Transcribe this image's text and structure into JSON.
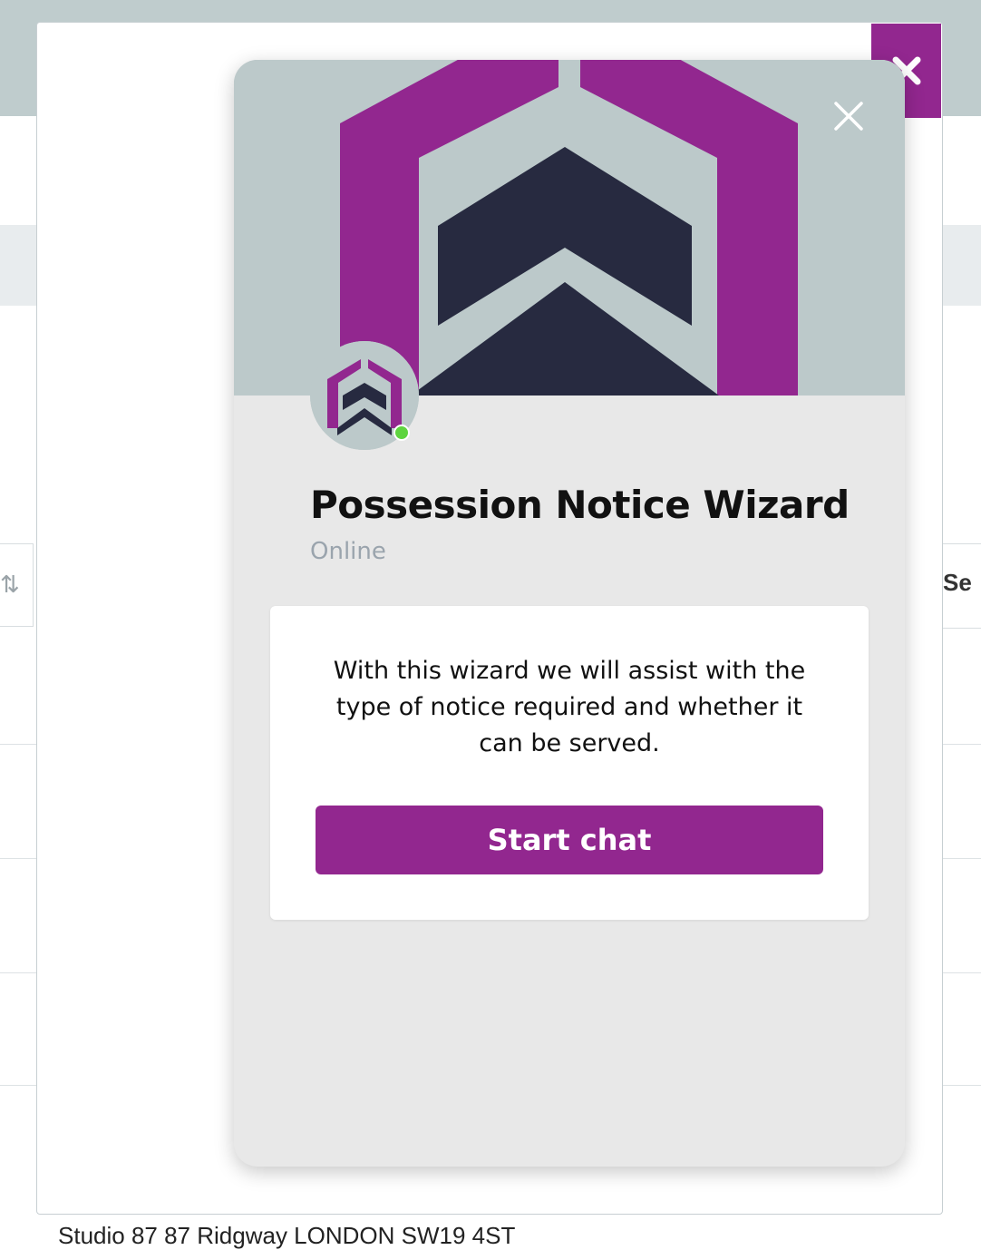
{
  "background_page": {
    "column_header_partial": "Se",
    "sort_icon": "sort-arrows-icon",
    "address_line": "Studio 87 87 Ridgway LONDON SW19 4ST"
  },
  "modal": {
    "close_icon": "close-x-icon"
  },
  "chat_widget": {
    "close_icon": "close-icon",
    "title": "Possession Notice Wizard",
    "status": "Online",
    "intro_message": "With this wizard we will assist with the type of notice required and whether it can be served.",
    "start_button_label": "Start chat",
    "colors": {
      "brand_purple": "#92278f",
      "dark_navy": "#272a40",
      "hero_grey": "#bcc9ca",
      "online_green": "#5ed43f"
    }
  }
}
